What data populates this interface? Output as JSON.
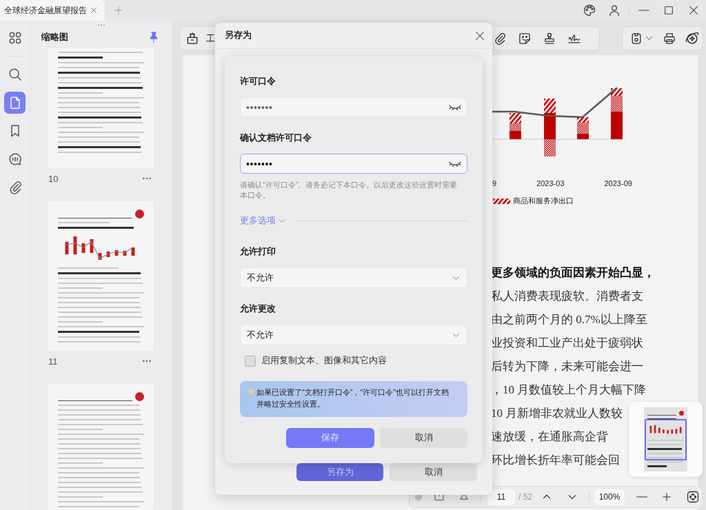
{
  "title_bar": {
    "tabs": [
      {
        "title": "全球经济金融展望报告",
        "selected": true
      }
    ]
  },
  "sidebar": {
    "rail": [
      {
        "kind": "apps",
        "selected": false
      },
      {
        "kind": "search",
        "selected": false
      },
      {
        "kind": "pages",
        "selected": true
      },
      {
        "kind": "bookmarks",
        "selected": false
      },
      {
        "kind": "comments",
        "selected": false
      },
      {
        "kind": "attachments",
        "selected": false
      }
    ],
    "panel_title": "缩略图",
    "pinned": true,
    "thumbnails": [
      {
        "kind": "text",
        "label": "10"
      },
      {
        "kind": "chart",
        "label": "11"
      },
      {
        "kind": "letterhead"
      }
    ]
  },
  "toolbar": {
    "tools_label": "工"
  },
  "document": {
    "chart": {
      "x_labels": [
        "9",
        "2023-03",
        "2023-09"
      ],
      "legend": "商品和服务净出口"
    },
    "lines": [
      {
        "text": "更多领域的负面因素开始凸显，",
        "bold": true
      },
      {
        "text": "私人消费表现疲软。消费者支",
        "bold": false
      },
      {
        "text": "由之前两个月的 0.7%以上降至",
        "bold": false
      },
      {
        "text": "业投资和工业产出处于疲弱状",
        "bold": false
      },
      {
        "text": "后转为下降，未来可能会进一",
        "bold": false
      },
      {
        "text": "，10 月数值较上个月大幅下降",
        "bold": false
      },
      {
        "text": "10 月新增非农就业人数较",
        "bold": false
      },
      {
        "text": "速放缓，在通胀高企背",
        "bold": false
      },
      {
        "text": "环比增长折年率可能会回",
        "bold": false
      }
    ]
  },
  "page_nav": {
    "page": "11",
    "total": "/ 52",
    "zoom": "100%"
  },
  "save_dialog": {
    "title": "另存为",
    "buttons": [
      {
        "label": "另存为",
        "kind": "primary"
      },
      {
        "label": "取消",
        "kind": "secondary"
      }
    ]
  },
  "permission_dialog": {
    "fields": [
      {
        "label": "许可口令",
        "value": "•••••••",
        "focused": false
      },
      {
        "label": "确认文档许可口令",
        "value": "•••••••",
        "focused": true
      }
    ],
    "hint": "请确认“许可口令”。请务必记下本口令。以后更改这些设置时需要本口令。",
    "more_options": {
      "label": "更多选项",
      "expanded": false
    },
    "selects": [
      {
        "label": "允许打印",
        "value": "不允许"
      },
      {
        "label": "允许更改",
        "value": "不允许"
      }
    ],
    "checkbox": {
      "label": "启用复制文本、图像和其它内容",
      "checked": false
    },
    "info": "如果已设置了“文档打开口令”，“许可口令”也可以打开文档并略过安全性设置。",
    "buttons": [
      {
        "label": "保存",
        "kind": "primary"
      },
      {
        "label": "取消",
        "kind": "secondary"
      }
    ]
  }
}
